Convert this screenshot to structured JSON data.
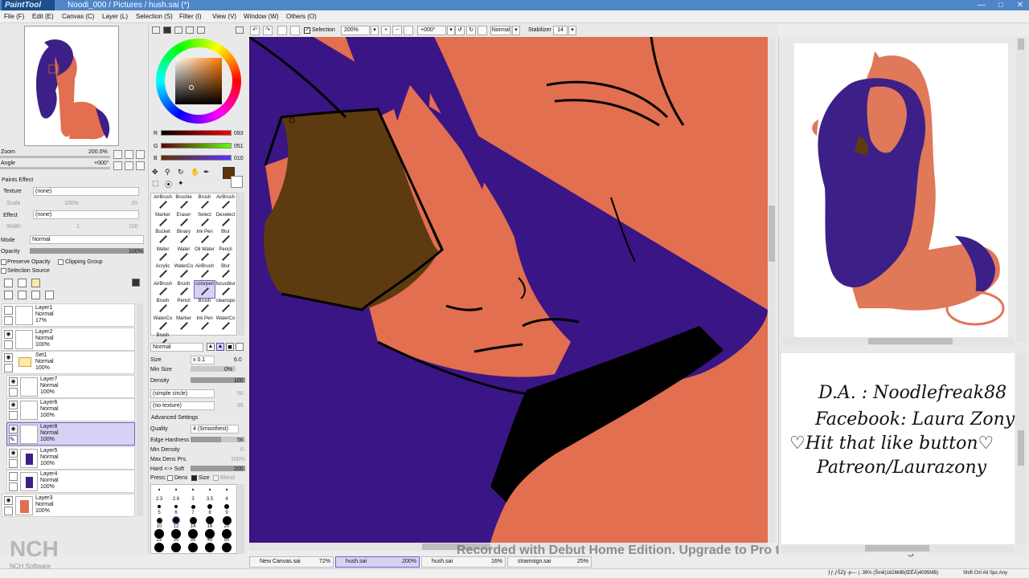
{
  "app": {
    "logo": "PaintTool SAI",
    "title": "Noodi_000 / Pictures / hush.sai (*)"
  },
  "menu": [
    "File (F)",
    "Edit (E)",
    "Canvas (C)",
    "Layer (L)",
    "Selection (S)",
    "Filter (I)",
    "View (V)",
    "Window (W)",
    "Others (O)"
  ],
  "navigator": {
    "zoom_label": "Zoom",
    "zoom_value": "200.0%",
    "angle_label": "Angle",
    "angle_value": "+000°"
  },
  "color": {
    "r_label": "R",
    "r": "093",
    "g_label": "G",
    "g": "051",
    "b_label": "B",
    "b": "010",
    "current": "#5d330a",
    "wheel_accent": "#ff0000"
  },
  "effects": {
    "header": "Paints Effect",
    "texture_label": "Texture",
    "texture_value": "(none)",
    "scale_label": "Scale",
    "scale_value": "100%",
    "scale_num": "20",
    "effect_label": "Effect",
    "effect_value": "(none)",
    "width_label": "Width",
    "width_value": "1",
    "width_num": "100"
  },
  "blend": {
    "mode_label": "Mode",
    "mode_value": "Normal",
    "opacity_label": "Opacity",
    "opacity_value": "100%",
    "preserve": "Preserve Opacity",
    "clipping": "Clipping Group",
    "selection_source": "Selection Source"
  },
  "layers": [
    {
      "name": "Layer1",
      "mode": "Normal",
      "opacity": "17%"
    },
    {
      "name": "Layer2",
      "mode": "Normal",
      "opacity": "100%"
    },
    {
      "name": "Set1",
      "mode": "Normal",
      "opacity": "100%"
    },
    {
      "name": "Layer7",
      "mode": "Normal",
      "opacity": "100%"
    },
    {
      "name": "Layer6",
      "mode": "Normal",
      "opacity": "100%"
    },
    {
      "name": "Layer8",
      "mode": "Normal",
      "opacity": "100%"
    },
    {
      "name": "Layer5",
      "mode": "Normal",
      "opacity": "100%"
    },
    {
      "name": "Layer4",
      "mode": "Normal",
      "opacity": "100%"
    },
    {
      "name": "Layer3",
      "mode": "Normal",
      "opacity": "100%"
    }
  ],
  "tools": [
    "AirBrush",
    "Brushie",
    "Brush",
    "AirBrush",
    "Marker",
    "Eraser",
    "Select",
    "Deselect",
    "Bucket",
    "Binary",
    "Ink Pen",
    "Blur",
    "Water",
    "Water",
    "Oil Water",
    "Pencil",
    "Acrylic",
    "WaterCo",
    "AirBrush",
    "Blur",
    "AirBrush",
    "Brush",
    "colorpen",
    "focusblur",
    "Brush",
    "Pencil",
    "Brush",
    "cleanspo",
    "WaterCo",
    "Marker",
    "Ink Pen",
    "WaterCo",
    "Brush"
  ],
  "tool_nums": [
    "9",
    "10"
  ],
  "brush": {
    "mode": "Normal",
    "size_label": "Size",
    "size_mult": "x 0.1",
    "size_value": "6.0",
    "min_size_label": "Min Size",
    "min_size_value": "0%",
    "density_label": "Density",
    "density_value": "100",
    "shape": "(simple circle)",
    "texture": "(no texture)",
    "shape_num": "50",
    "texture_num": "95",
    "advanced": "Advanced Settings",
    "quality_label": "Quality",
    "quality_value": "4 (Smoothest)",
    "edge_label": "Edge Hardness",
    "edge_value": "56",
    "min_density_label": "Min Density",
    "min_density_value": "0",
    "max_dens_label": "Max Dens Prs.",
    "max_dens_value": "100%",
    "hard_soft_label": "Hard <-> Soft",
    "hard_soft_value": "200",
    "press_label": "Press:",
    "dens_label": "Dens",
    "size_chk_label": "Size",
    "blend_label": "Blend"
  },
  "size_presets": [
    ".",
    ".",
    ".",
    ".",
    ".",
    "2.3",
    "2.6",
    "3",
    "3.5",
    "4",
    "5",
    "6",
    "7",
    "8",
    "9",
    "10",
    "12",
    "14",
    "16",
    "20",
    "25",
    "30",
    "35",
    "40",
    "50"
  ],
  "toolbar": {
    "selection_label": "Selection",
    "zoom": "200%",
    "angle": "+000°",
    "mode": "Normal",
    "stabilizer_label": "Stabilizer",
    "stabilizer_value": "14"
  },
  "canvas_tabs": [
    {
      "name": "New Canvas.sai",
      "pct": "72%"
    },
    {
      "name": "hush.sai",
      "pct": "200%"
    },
    {
      "name": "hush.sai",
      "pct": "16%"
    },
    {
      "name": "stramsign.sai",
      "pct": "25%"
    }
  ],
  "credits": {
    "line1": "D.A. : Noodlefreak88",
    "line2": "Facebook: Laura Zony",
    "line3": "♡Hit that like button♡",
    "line4": "Patreon/Laurazony"
  },
  "watermark": "Recorded with Debut Home Edition. Upgrade to Pro to remove this message",
  "nch": {
    "logo": "NCH",
    "sub": "NCH Software"
  },
  "status": "ƒƒ,ƒŠZŷ -р–– | :39% (Šm€)1626MB(ŒÉÄ)4095MB)",
  "status_right": "Shift Ctrl Alt Spc Any"
}
